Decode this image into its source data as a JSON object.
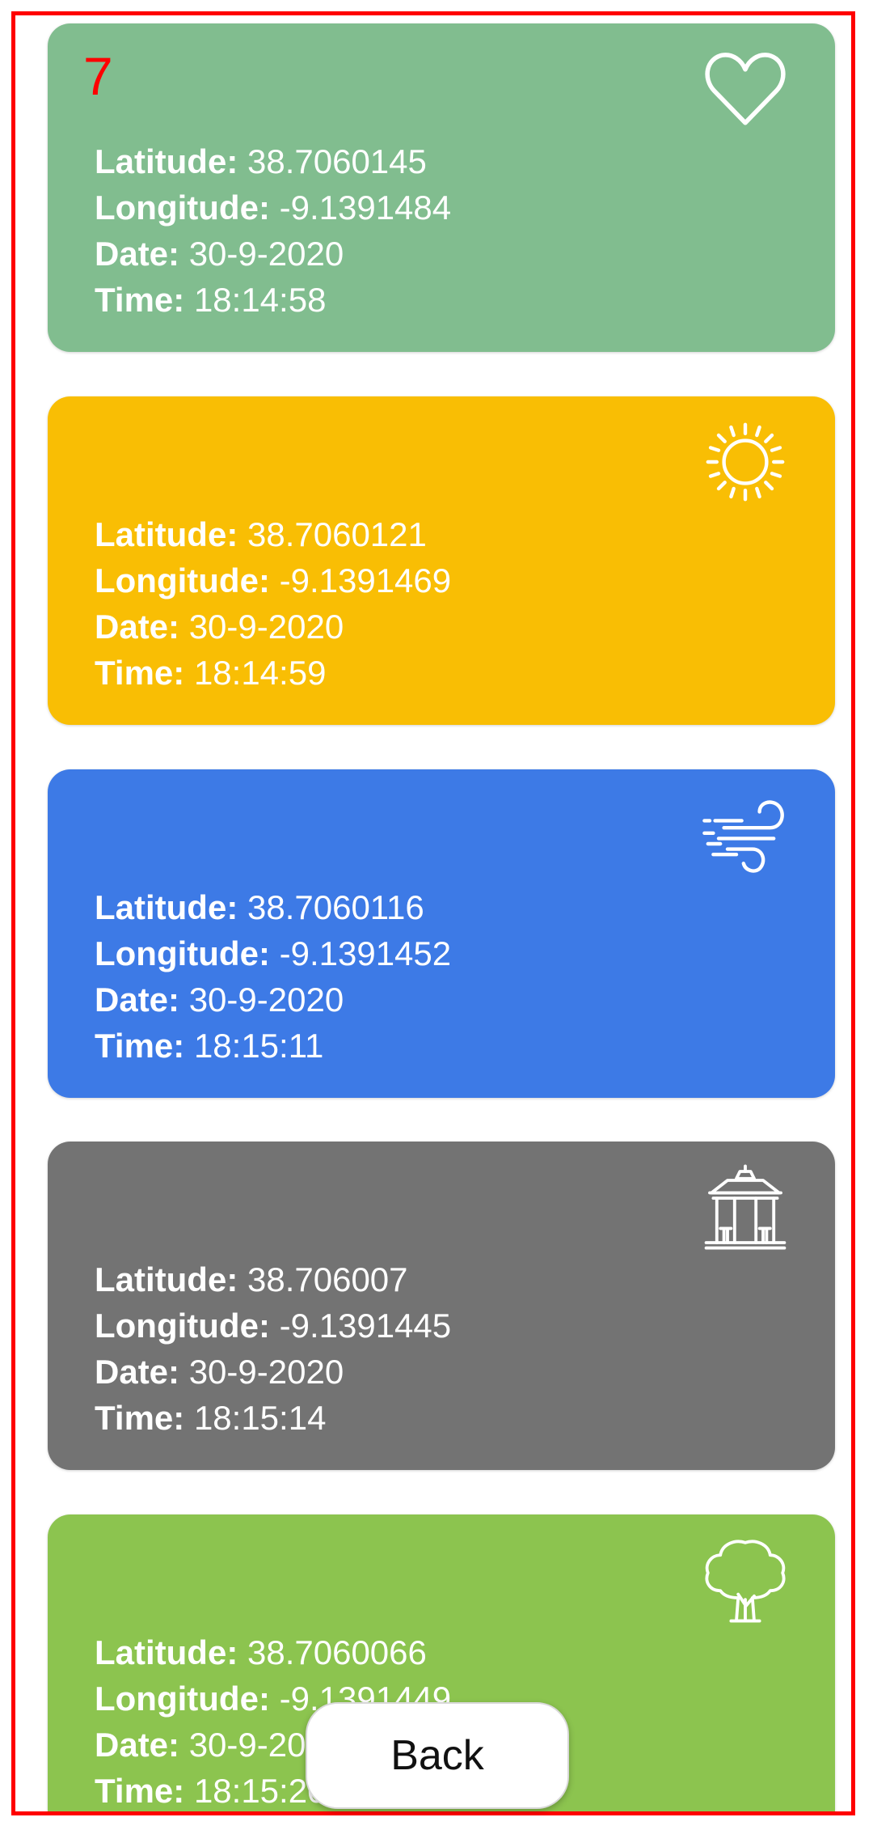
{
  "colors": {
    "frame_border": "#ff0000",
    "badge_number": "#ff0000"
  },
  "cards": [
    {
      "number": "7",
      "icon": "heart-icon",
      "color": "#81bd8f",
      "latitude_label": "Latitude:",
      "latitude": "38.7060145",
      "longitude_label": "Longitude:",
      "longitude": "-9.1391484",
      "date_label": "Date:",
      "date": "30-9-2020",
      "time_label": "Time:",
      "time": "18:14:58"
    },
    {
      "number": "",
      "icon": "sun-icon",
      "color": "#f9be04",
      "latitude_label": "Latitude:",
      "latitude": "38.7060121",
      "longitude_label": "Longitude:",
      "longitude": "-9.1391469",
      "date_label": "Date:",
      "date": "30-9-2020",
      "time_label": "Time:",
      "time": "18:14:59"
    },
    {
      "number": "",
      "icon": "wind-icon",
      "color": "#3d7ae6",
      "latitude_label": "Latitude:",
      "latitude": "38.7060116",
      "longitude_label": "Longitude:",
      "longitude": "-9.1391452",
      "date_label": "Date:",
      "date": "30-9-2020",
      "time_label": "Time:",
      "time": "18:15:11"
    },
    {
      "number": "",
      "icon": "gazebo-icon",
      "color": "#737373",
      "latitude_label": "Latitude:",
      "latitude": "38.706007",
      "longitude_label": "Longitude:",
      "longitude": "-9.1391445",
      "date_label": "Date:",
      "date": "30-9-2020",
      "time_label": "Time:",
      "time": "18:15:14"
    },
    {
      "number": "",
      "icon": "tree-icon",
      "color": "#8cc44f",
      "latitude_label": "Latitude:",
      "latitude": "38.7060066",
      "longitude_label": "Longitude:",
      "longitude": "-9.1391449",
      "date_label": "Date:",
      "date": "30-9-2020",
      "time_label": "Time:",
      "time": "18:15:20"
    }
  ],
  "back_button": {
    "label": "Back"
  }
}
